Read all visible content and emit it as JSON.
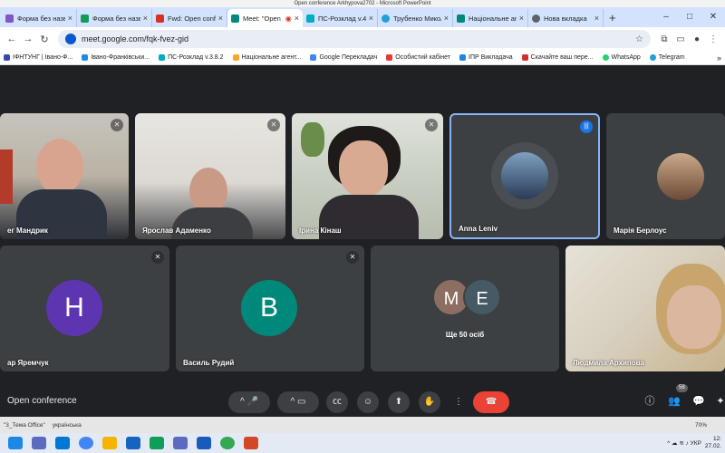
{
  "pp_window_title": "Open conference Arkhypova2702 - Microsoft PowerPoint",
  "tabs": [
    {
      "label": "Форма без назв",
      "color": "#7e57c2"
    },
    {
      "label": "Форма без назв",
      "color": "#0f9d58"
    },
    {
      "label": "Fwd: Open confe",
      "color": "#d93025"
    },
    {
      "label": "Meet: \"Open",
      "color": "#00897b",
      "active": true
    },
    {
      "label": "ПС-Розклад v.4.0",
      "color": "#00acc1"
    },
    {
      "label": "Трубенко Микол",
      "color": "#229ed9"
    },
    {
      "label": "Національне аге",
      "color": "#00897b"
    },
    {
      "label": "Нова вкладка",
      "color": "#5f6368"
    }
  ],
  "new_tab": "+",
  "address": "meet.google.com/fqk-fvez-gid",
  "bookmarks": [
    {
      "label": "ІФНТУНГ | Івано-Ф...",
      "color": "#3949ab"
    },
    {
      "label": "Івано-Франківськи...",
      "color": "#1e88e5"
    },
    {
      "label": "ПС-Розклад v.3.8.2",
      "color": "#00acc1"
    },
    {
      "label": "Національне агент...",
      "color": "#f9a825"
    },
    {
      "label": "Google Перекладач",
      "color": "#4285f4"
    },
    {
      "label": "Особистий кабінет",
      "color": "#e53935"
    },
    {
      "label": "ІПР Викладача",
      "color": "#1e88e5"
    },
    {
      "label": "Скачайте ваш пере...",
      "color": "#d32f2f"
    },
    {
      "label": "WhatsApp",
      "color": "#25d366"
    },
    {
      "label": "Telegram",
      "color": "#229ed9"
    }
  ],
  "participants": [
    {
      "name": "ег Мандрик",
      "muted": true
    },
    {
      "name": "Ярослав Адаменко",
      "muted": true
    },
    {
      "name": "Ірина Кінаш",
      "muted": true
    },
    {
      "name": "Anna Leniv",
      "speaking": true
    },
    {
      "name": "Марія Берлоус"
    },
    {
      "name": "ар Яремчук",
      "initial": "H",
      "color": "#5e35b1",
      "muted": true
    },
    {
      "name": "Василь Рудий",
      "initial": "B",
      "color": "#00897b",
      "muted": true
    },
    {
      "name": "Ще 50 осіб",
      "initials": [
        "M",
        "E"
      ]
    },
    {
      "name": "Людмила Архипова"
    }
  ],
  "meeting_name": "Open conference",
  "people_count": "58",
  "ppt_status": {
    "slide": "\"3_Тема Office\"",
    "lang": "українська",
    "zoom": "70%"
  },
  "clock": {
    "time": "12:",
    "date": "27.02."
  },
  "tray_lang": "УКР"
}
